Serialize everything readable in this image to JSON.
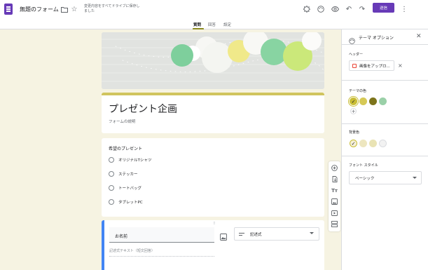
{
  "app": {
    "title": "無題のフォーム",
    "autosave_text": "変更内容をすべてドライブに保存しました",
    "send_label": "送信"
  },
  "tabs": [
    {
      "label": "質問",
      "active": true
    },
    {
      "label": "回答",
      "active": false
    },
    {
      "label": "設定",
      "active": false
    }
  ],
  "form": {
    "title": "プレゼント企画",
    "description_placeholder": "フォームの説明"
  },
  "question1": {
    "title": "希望のプレゼント",
    "options": [
      "オリジナルTシャツ",
      "ステッカー",
      "トートバッグ",
      "タブレットPC"
    ]
  },
  "question2": {
    "title": "お名前",
    "type_label": "記述式",
    "answer_placeholder": "記述式テキスト（短文回答）"
  },
  "theme_panel": {
    "title": "テーマ オプション",
    "header_label": "ヘッダー",
    "header_chip": "画像をアップロ...",
    "theme_color_label": "テーマの色",
    "theme_colors": [
      "#c9bd35",
      "#d6c956",
      "#7d741b",
      "#9ad0a8"
    ],
    "selected_theme_color": 0,
    "bg_color_label": "背景色",
    "bg_colors": [
      "#f5f0d8",
      "#ede6bf",
      "#e9e3b4",
      "#f2f2f2"
    ],
    "selected_bg_color": 0,
    "font_style_label": "フォント スタイル",
    "font_style_value": "ベーシック"
  },
  "colors": {
    "accent": "#673ab7",
    "theme_bar": "#d0c45e",
    "active_card": "#4285f4"
  }
}
